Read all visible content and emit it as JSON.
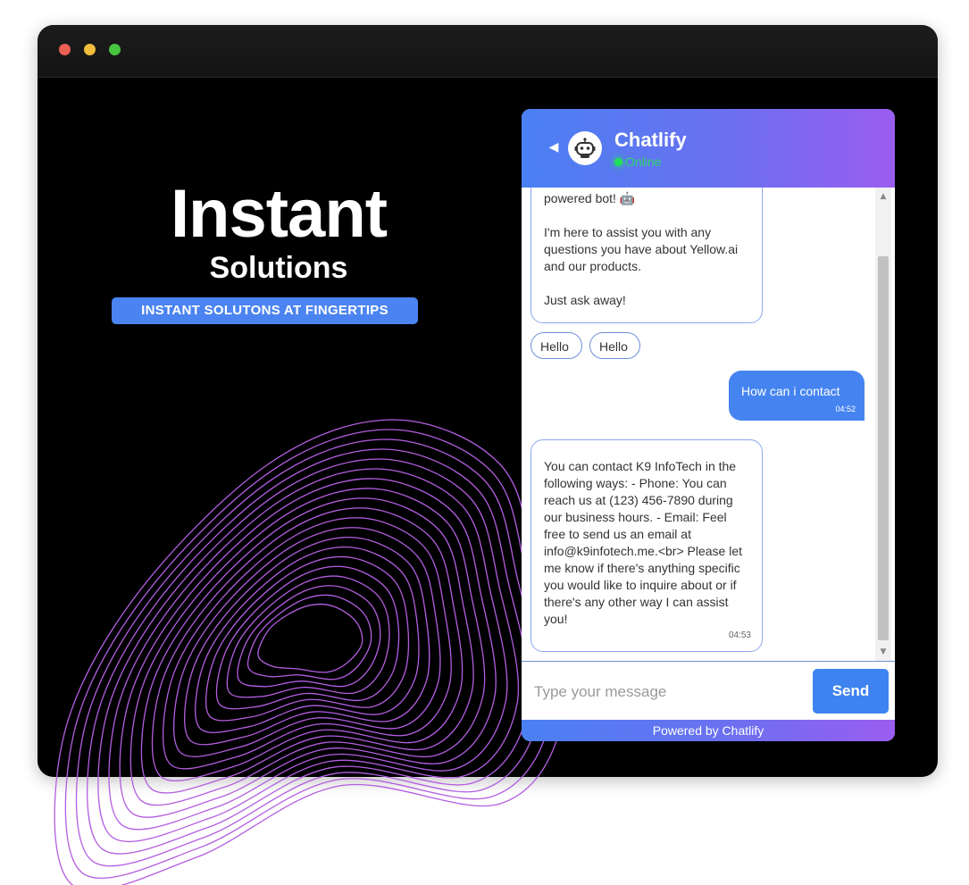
{
  "hero": {
    "title": "Instant",
    "subtitle": "Solutions",
    "badge": "INSTANT SOLUTONS AT FINGERTIPS"
  },
  "chat": {
    "name": "Chatlify",
    "status": "Online",
    "messages": {
      "bot_intro": {
        "line1": "powered bot! 🤖",
        "para2": "I'm here to assist you with any questions you have about Yellow.ai and our products.",
        "para3": "Just ask away!"
      },
      "quick_replies": [
        "Hello",
        "Hello"
      ],
      "user_message": {
        "text": "How can i contact",
        "time": "04:52"
      },
      "bot_reply": {
        "text": "You can contact K9 InfoTech in the following ways: - Phone: You can reach us at (123) 456-7890 during our business hours. - Email: Feel free to send us an email at info@k9infotech.me.<br> Please let me know if there's anything specific you would like to inquire about or if there's any other way I can assist you!",
        "time": "04:53"
      }
    },
    "input_placeholder": "Type your message",
    "send_label": "Send",
    "footer": "Powered by Chatlify"
  },
  "colors": {
    "accent_blue": "#4584f0",
    "header_gradient_start": "#4a80f2",
    "header_gradient_end": "#9a5df0",
    "online_green": "#22e05a",
    "wave_purple": "#b35ee0"
  },
  "icons": {
    "back": "chevron-left-icon",
    "avatar": "robot-icon",
    "scroll_up": "triangle-up-icon",
    "scroll_down": "triangle-down-icon"
  }
}
